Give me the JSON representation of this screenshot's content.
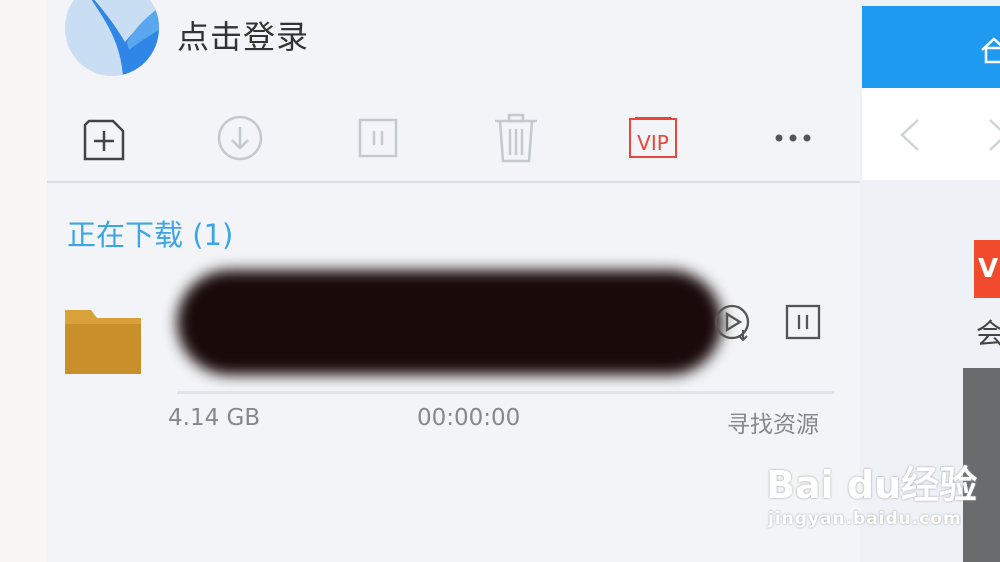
{
  "header": {
    "login_label": "点击登录"
  },
  "toolbar": {
    "new_task": "new-task-icon",
    "download": "download-icon",
    "pause": "pause-icon",
    "delete": "trash-icon",
    "vip_label": "VIP",
    "more": "more-icon"
  },
  "section": {
    "title": "正在下载 (1)"
  },
  "download_item": {
    "file_name": "",
    "size": "4.14 GB",
    "time": "00:00:00",
    "find_resources": "寻找资源",
    "progress": 0
  },
  "side_panel": {
    "badge": "V",
    "text": "会"
  },
  "watermark": {
    "brand": "Bai du经验",
    "url": "jingyan.baidu.com"
  },
  "colors": {
    "accent": "#3aa6e6",
    "vip": "#e8463a",
    "topbar": "#1e9bf0"
  }
}
